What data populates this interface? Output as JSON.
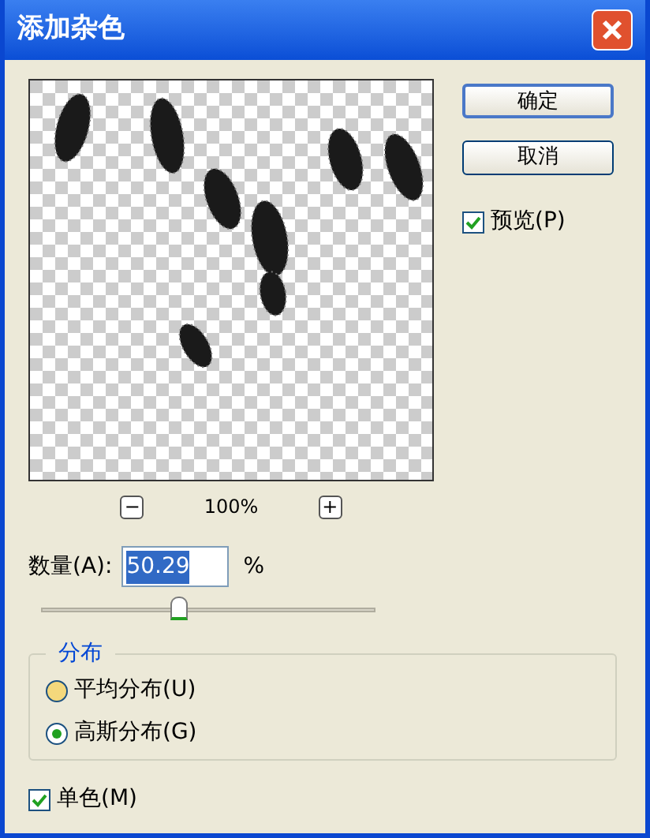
{
  "window": {
    "title": "添加杂色"
  },
  "buttons": [
    {
      "label": "确定",
      "default": true
    },
    {
      "label": "取消",
      "default": false
    }
  ],
  "preview_option": {
    "label": "预览(P)",
    "checked": true
  },
  "zoom": {
    "minus": "−",
    "value": "100%",
    "plus": "+"
  },
  "amount": {
    "label": "数量(A):",
    "value": "50.29",
    "selected": true,
    "unit": "%",
    "level": 0.41
  },
  "distribution": {
    "title": "分布",
    "options": [
      {
        "label": "平均分布(U)",
        "selected": false
      },
      {
        "label": "高斯分布(G)",
        "selected": true
      }
    ]
  },
  "monochrome": {
    "label": "单色(M)",
    "checked": true
  }
}
